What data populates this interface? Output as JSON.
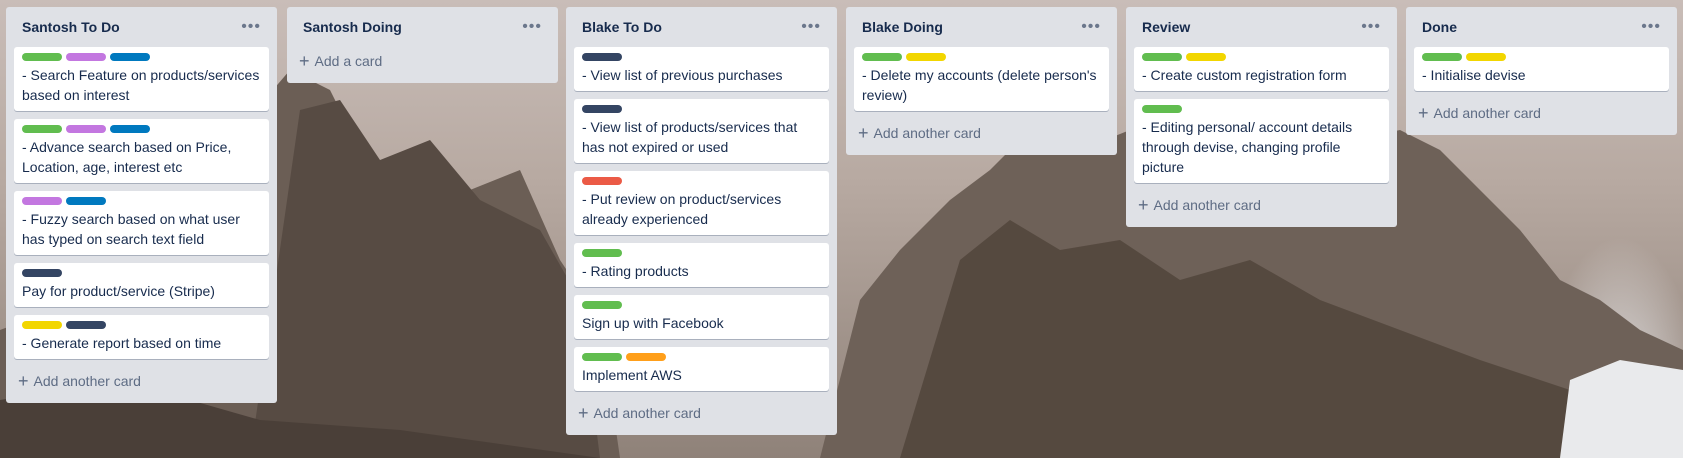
{
  "colors": {
    "green": "#61bd4f",
    "purple": "#c377e0",
    "blue": "#0079bf",
    "dark": "#344563",
    "red": "#eb5a46",
    "yellow": "#f2d600",
    "orange": "#ff9f1a"
  },
  "menu_icon": "•••",
  "plus_icon": "+",
  "lists": [
    {
      "title": "Santosh To Do",
      "add_label": "Add another card",
      "cards": [
        {
          "labels": [
            "green",
            "purple",
            "blue"
          ],
          "text": "- Search Feature on products/services based on interest"
        },
        {
          "labels": [
            "green",
            "purple",
            "blue"
          ],
          "text": "- Advance search based on Price, Location, age, interest etc"
        },
        {
          "labels": [
            "purple",
            "blue"
          ],
          "text": "- Fuzzy search based on what user has typed on search text field"
        },
        {
          "labels": [
            "dark"
          ],
          "text": "Pay for product/service (Stripe)"
        },
        {
          "labels": [
            "yellow",
            "dark"
          ],
          "text": "- Generate report based on time"
        }
      ]
    },
    {
      "title": "Santosh Doing",
      "add_label": "Add a card",
      "cards": []
    },
    {
      "title": "Blake To Do",
      "add_label": "Add another card",
      "cards": [
        {
          "labels": [
            "dark"
          ],
          "text": "- View list of previous purchases"
        },
        {
          "labels": [
            "dark"
          ],
          "text": "- View list of products/services that has not expired or used"
        },
        {
          "labels": [
            "red"
          ],
          "text": "- Put review on product/services already experienced"
        },
        {
          "labels": [
            "green"
          ],
          "text": "- Rating products"
        },
        {
          "labels": [
            "green"
          ],
          "text": "Sign up with Facebook"
        },
        {
          "labels": [
            "green",
            "orange"
          ],
          "text": "Implement AWS"
        }
      ]
    },
    {
      "title": "Blake Doing",
      "add_label": "Add another card",
      "cards": [
        {
          "labels": [
            "green",
            "yellow"
          ],
          "text": "- Delete my accounts (delete person's review)"
        }
      ]
    },
    {
      "title": "Review",
      "add_label": "Add another card",
      "cards": [
        {
          "labels": [
            "green",
            "yellow"
          ],
          "text": "- Create custom registration form"
        },
        {
          "labels": [
            "green"
          ],
          "text": "- Editing personal/ account details through devise, changing profile picture"
        }
      ]
    },
    {
      "title": "Done",
      "add_label": "Add another card",
      "cards": [
        {
          "labels": [
            "green",
            "yellow"
          ],
          "text": "- Initialise devise"
        }
      ]
    }
  ]
}
